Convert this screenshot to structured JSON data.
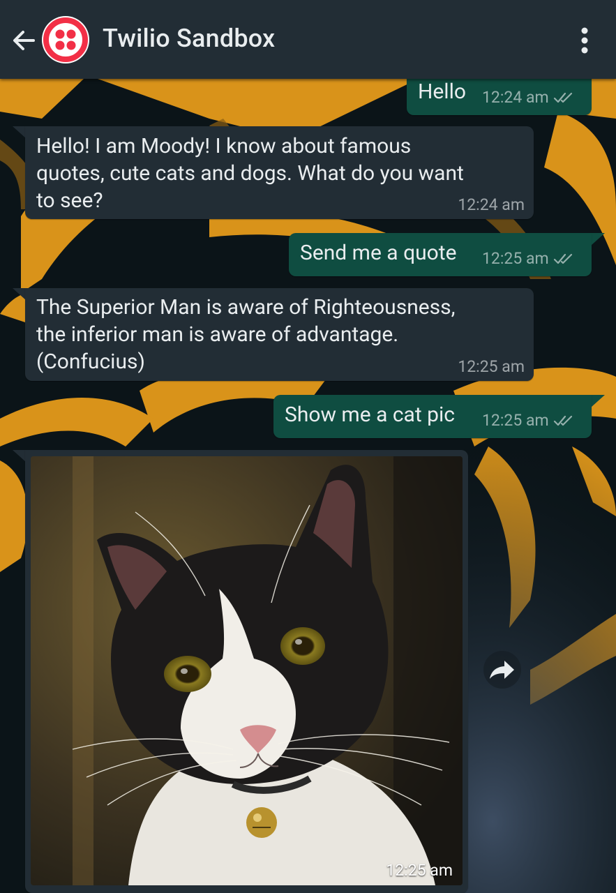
{
  "header": {
    "back_icon": "arrow-left-icon",
    "avatar_icon": "twilio-logo-icon",
    "title": "Twilio Sandbox",
    "menu_icon": "more-vertical-icon"
  },
  "messages": [
    {
      "direction": "outgoing",
      "text": "Hello",
      "time": "12:24 am",
      "status": "read"
    },
    {
      "direction": "incoming",
      "text": "Hello! I am Moody! I know about famous\nquotes, cute cats and dogs. What do you want\nto see?",
      "time": "12:24 am"
    },
    {
      "direction": "outgoing",
      "text": "Send me a quote",
      "time": "12:25 am",
      "status": "read"
    },
    {
      "direction": "incoming",
      "text": "The Superior Man is aware of Righteousness,\nthe inferior man is aware of advantage.\n(Confucius)",
      "time": "12:25 am"
    },
    {
      "direction": "outgoing",
      "text": "Show me a cat pic",
      "time": "12:25 am",
      "status": "read"
    },
    {
      "direction": "incoming",
      "type": "image",
      "image": "black-and-white-cat-photo",
      "time": "12:25 am"
    }
  ],
  "forward_icon": "forward-arrow-icon",
  "colors": {
    "header_bg": "#222d35",
    "incoming_bubble": "#222d35",
    "outgoing_bubble": "#0f4d41",
    "twilio_red": "#f22f46",
    "wallpaper_accent": "#e8a21a"
  }
}
